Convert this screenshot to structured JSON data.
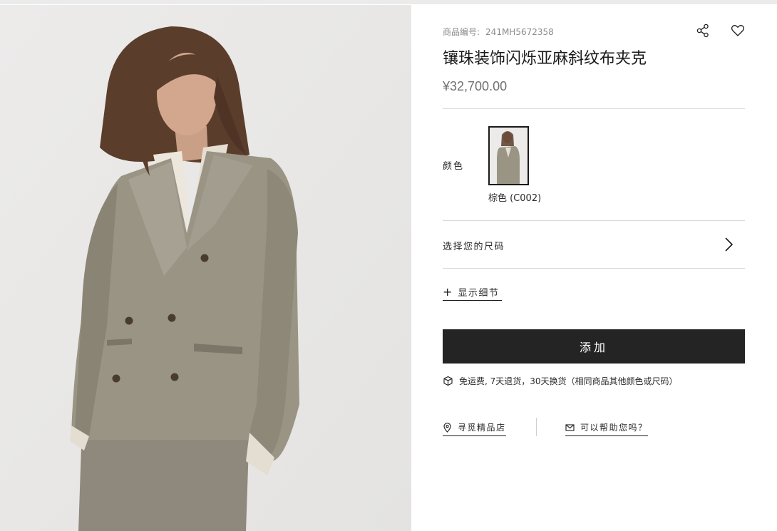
{
  "product": {
    "sku_label": "商品编号:",
    "sku_value": "241MH5672358",
    "title": "镶珠装饰闪烁亚麻斜纹布夹克",
    "price": "¥32,700.00"
  },
  "actions": {
    "share_icon": "share-icon",
    "favorite_icon": "heart-icon"
  },
  "color": {
    "label": "颜色",
    "selected": "棕色 (C002)"
  },
  "size": {
    "label": "选择您的尺码"
  },
  "details": {
    "label": "显示细节"
  },
  "cart": {
    "add_label": "添加"
  },
  "shipping": {
    "text": "免运费, 7天退货，30天换货（相同商品其他颜色或尺码）"
  },
  "links": {
    "store_label": "寻觅精品店",
    "help_label": "可以帮助您吗？"
  },
  "colors": {
    "button_bg": "#242424",
    "divider": "#d9d9d9",
    "jacket": "#9a9485"
  }
}
